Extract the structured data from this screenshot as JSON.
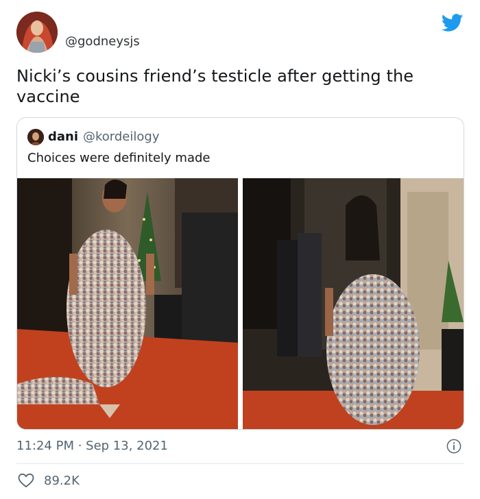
{
  "author": {
    "handle": "@godneysjs",
    "avatar": "profile-photo"
  },
  "tweet": {
    "text": "Nicki’s cousins friend’s testicle after getting the vaccine"
  },
  "quoted_tweet": {
    "name": "dani",
    "handle": "@kordeilogy",
    "text": "Choices were definitely made",
    "images": [
      {
        "description_icon": "photo-sequined-gown-front"
      },
      {
        "description_icon": "photo-sequined-gown-back"
      }
    ]
  },
  "meta": {
    "timestamp": "11:24 PM · Sep 13, 2021",
    "likes": "89.2K"
  },
  "icons": {
    "brand": "twitter-bird-icon",
    "info": "info-icon",
    "like": "heart-icon"
  },
  "colors": {
    "twitter_blue": "#1d9bf0",
    "secondary_text": "#536471",
    "border": "#cfd9de"
  }
}
